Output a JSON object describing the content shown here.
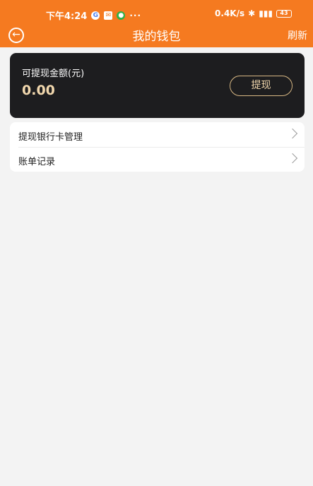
{
  "status_bar": {
    "time": "下午4:24",
    "icon_g": "G",
    "icon_mail": "✉",
    "icon_wechat": "●",
    "dots": "···",
    "speed": "0.4K/s",
    "battery": "43"
  },
  "header": {
    "title": "我的钱包",
    "refresh_label": "刷新",
    "back_icon": "←"
  },
  "wallet": {
    "label": "可提现金额(元)",
    "amount": "0.00",
    "withdraw_label": "提现"
  },
  "menu": {
    "items": [
      {
        "label": "提现银行卡管理"
      },
      {
        "label": "账单记录"
      }
    ]
  },
  "colors": {
    "accent": "#f57a20",
    "card_bg": "#1d1d1f",
    "gold": "#f1d7ad"
  }
}
